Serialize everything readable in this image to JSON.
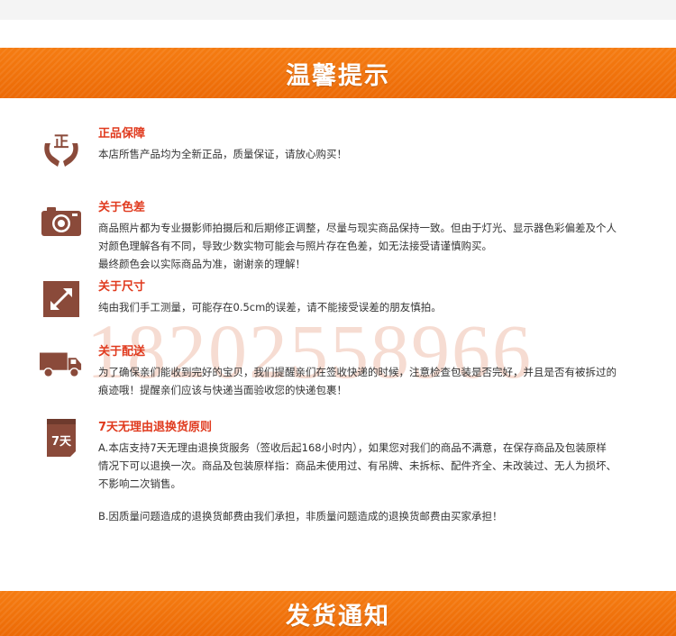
{
  "header_title": "温馨提示",
  "footer_title": "发货通知",
  "watermark": "18202558966",
  "icons": {
    "genuine": "hands-holding-genuine-icon",
    "color": "camera-icon",
    "size": "diagonal-arrow-icon",
    "delivery": "delivery-truck-icon",
    "returns": "seven-day-calendar-icon"
  },
  "icon_glyphs": {
    "genuine": "正",
    "returns": "7天"
  },
  "colors": {
    "accent": "#ec6a06",
    "title_red": "#e03a1e",
    "icon_brown": "#8a4a3a"
  },
  "items": [
    {
      "title": "正品保障",
      "lines": [
        "本店所售产品均为全新正品，质量保证，请放心购买！"
      ]
    },
    {
      "title": "关于色差",
      "lines": [
        "商品照片都为专业摄影师拍摄后和后期修正调整，尽量与现实商品保持一致。但由于灯光、显示器色彩偏差及个人",
        "对颜色理解各有不同，导致少数实物可能会与照片存在色差，如无法接受请谨慎购买。",
        "最终颜色会以实际商品为准，谢谢亲的理解！"
      ]
    },
    {
      "title": "关于尺寸",
      "lines": [
        "纯由我们手工测量，可能存在0.5cm的误差，请不能接受误差的朋友慎拍。"
      ]
    },
    {
      "title": "关于配送",
      "lines": [
        "为了确保亲们能收到完好的宝贝，我们提醒亲们在签收快递的时候，注意检查包装是否完好，并且是否有被拆过的",
        "痕迹哦！提醒亲们应该与快递当面验收您的快递包裹！"
      ]
    },
    {
      "title": "7天无理由退换货原则",
      "lines_a": [
        "A.本店支持7天无理由退换货服务（签收后起168小时内），如果您对我们的商品不满意，在保存商品及包装原样",
        "情况下可以退换一次。商品及包装原样指：商品未使用过、有吊牌、未拆标、配件齐全、未改装过、无人为损坏、",
        "不影响二次销售。"
      ],
      "lines_b": [
        "B.因质量问题造成的退换货邮费由我们承担，非质量问题造成的退换货邮费由买家承担！"
      ]
    }
  ]
}
